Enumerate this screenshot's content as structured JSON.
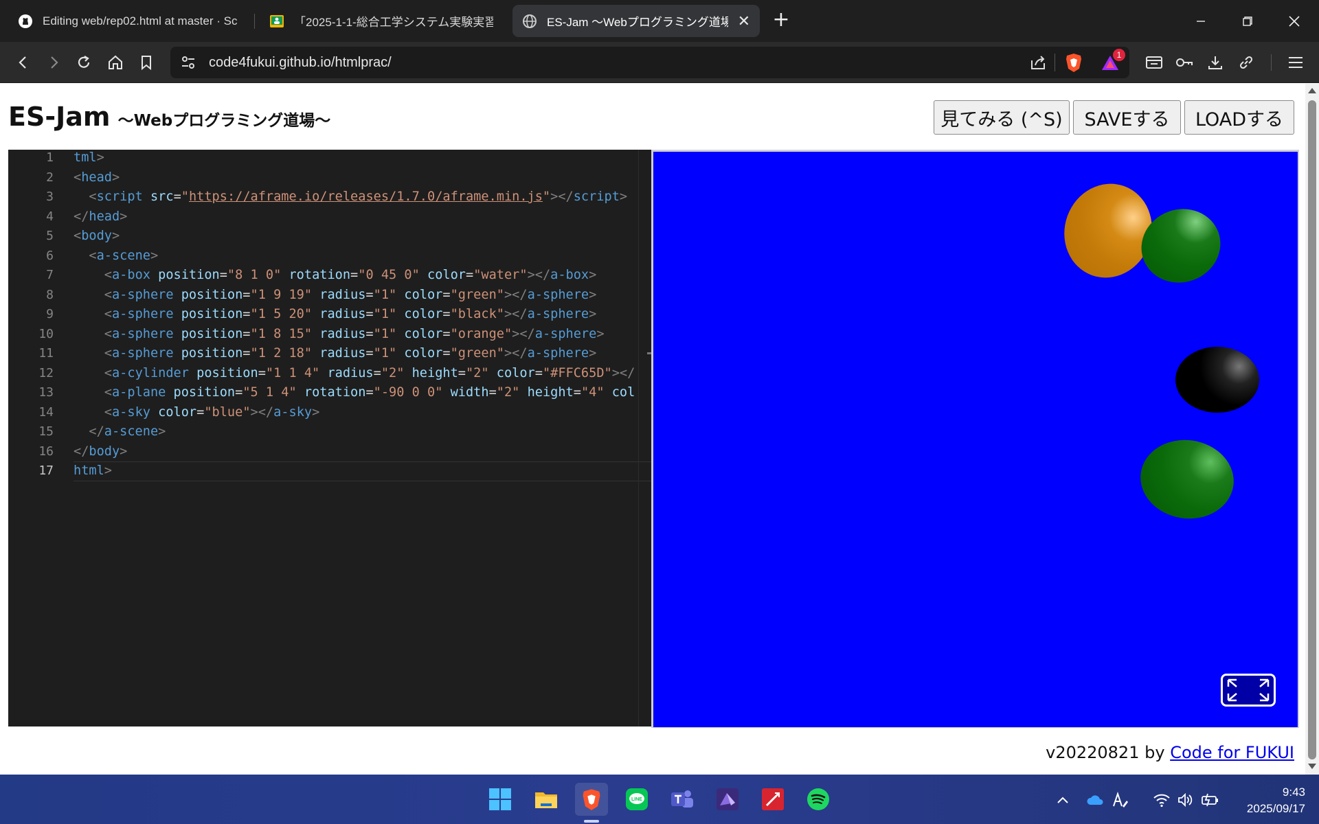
{
  "tabs": [
    {
      "title": "Editing web/rep02.html at master · Sc",
      "favicon": "github-icon",
      "active": false
    },
    {
      "title": "「2025-1-1-総合工学システム実験実習",
      "favicon": "classroom-icon",
      "active": false
    },
    {
      "title": "ES-Jam 〜Webプログラミング道場〜",
      "favicon": "globe-icon",
      "active": true
    }
  ],
  "address_bar": {
    "url": "code4fukui.github.io/htmlprac/"
  },
  "badges": {
    "rewards": "1"
  },
  "page": {
    "title": "ES-Jam",
    "subtitle": "〜Webプログラミング道場〜",
    "buttons": {
      "preview": "見てみる (^S)",
      "save": "SAVEする",
      "load": "LOADする"
    },
    "footer_version": "v20220821 by",
    "footer_link": "Code for FUKUI"
  },
  "editor": {
    "line_numbers": [
      "1",
      "2",
      "3",
      "4",
      "5",
      "6",
      "7",
      "8",
      "9",
      "10",
      "11",
      "12",
      "13",
      "14",
      "15",
      "16",
      "17"
    ],
    "current_line": 17,
    "lines": [
      [
        {
          "c": "tag",
          "t": "tml"
        },
        {
          "c": "br",
          "t": ">"
        }
      ],
      [
        {
          "c": "br",
          "t": "<"
        },
        {
          "c": "tag",
          "t": "head"
        },
        {
          "c": "br",
          "t": ">"
        }
      ],
      [
        {
          "c": "sp",
          "t": "  "
        },
        {
          "c": "br",
          "t": "<"
        },
        {
          "c": "tag",
          "t": "script "
        },
        {
          "c": "attr",
          "t": "src"
        },
        {
          "c": "eq",
          "t": "="
        },
        {
          "c": "str",
          "t": "\""
        },
        {
          "c": "url",
          "t": "https://aframe.io/releases/1.7.0/aframe.min.js"
        },
        {
          "c": "str",
          "t": "\""
        },
        {
          "c": "br",
          "t": "></"
        },
        {
          "c": "tag",
          "t": "script"
        },
        {
          "c": "br",
          "t": ">"
        }
      ],
      [
        {
          "c": "br",
          "t": "</"
        },
        {
          "c": "tag",
          "t": "head"
        },
        {
          "c": "br",
          "t": ">"
        }
      ],
      [
        {
          "c": "br",
          "t": "<"
        },
        {
          "c": "tag",
          "t": "body"
        },
        {
          "c": "br",
          "t": ">"
        }
      ],
      [
        {
          "c": "sp",
          "t": "  "
        },
        {
          "c": "br",
          "t": "<"
        },
        {
          "c": "tag",
          "t": "a-scene"
        },
        {
          "c": "br",
          "t": ">"
        }
      ],
      [
        {
          "c": "sp",
          "t": "    "
        },
        {
          "c": "br",
          "t": "<"
        },
        {
          "c": "tag",
          "t": "a-box "
        },
        {
          "c": "attr",
          "t": "position"
        },
        {
          "c": "eq",
          "t": "="
        },
        {
          "c": "str",
          "t": "\"8 1 0\" "
        },
        {
          "c": "attr",
          "t": "rotation"
        },
        {
          "c": "eq",
          "t": "="
        },
        {
          "c": "str",
          "t": "\"0 45 0\" "
        },
        {
          "c": "attr",
          "t": "color"
        },
        {
          "c": "eq",
          "t": "="
        },
        {
          "c": "str",
          "t": "\"water\""
        },
        {
          "c": "br",
          "t": "></"
        },
        {
          "c": "tag",
          "t": "a-box"
        },
        {
          "c": "br",
          "t": ">"
        }
      ],
      [
        {
          "c": "sp",
          "t": "    "
        },
        {
          "c": "br",
          "t": "<"
        },
        {
          "c": "tag",
          "t": "a-sphere "
        },
        {
          "c": "attr",
          "t": "position"
        },
        {
          "c": "eq",
          "t": "="
        },
        {
          "c": "str",
          "t": "\"1 9 19\" "
        },
        {
          "c": "attr",
          "t": "radius"
        },
        {
          "c": "eq",
          "t": "="
        },
        {
          "c": "str",
          "t": "\"1\" "
        },
        {
          "c": "attr",
          "t": "color"
        },
        {
          "c": "eq",
          "t": "="
        },
        {
          "c": "str",
          "t": "\"green\""
        },
        {
          "c": "br",
          "t": "></"
        },
        {
          "c": "tag",
          "t": "a-sphere"
        },
        {
          "c": "br",
          "t": ">"
        }
      ],
      [
        {
          "c": "sp",
          "t": "    "
        },
        {
          "c": "br",
          "t": "<"
        },
        {
          "c": "tag",
          "t": "a-sphere "
        },
        {
          "c": "attr",
          "t": "position"
        },
        {
          "c": "eq",
          "t": "="
        },
        {
          "c": "str",
          "t": "\"1 5 20\" "
        },
        {
          "c": "attr",
          "t": "radius"
        },
        {
          "c": "eq",
          "t": "="
        },
        {
          "c": "str",
          "t": "\"1\" "
        },
        {
          "c": "attr",
          "t": "color"
        },
        {
          "c": "eq",
          "t": "="
        },
        {
          "c": "str",
          "t": "\"black\""
        },
        {
          "c": "br",
          "t": "></"
        },
        {
          "c": "tag",
          "t": "a-sphere"
        },
        {
          "c": "br",
          "t": ">"
        }
      ],
      [
        {
          "c": "sp",
          "t": "    "
        },
        {
          "c": "br",
          "t": "<"
        },
        {
          "c": "tag",
          "t": "a-sphere "
        },
        {
          "c": "attr",
          "t": "position"
        },
        {
          "c": "eq",
          "t": "="
        },
        {
          "c": "str",
          "t": "\"1 8 15\" "
        },
        {
          "c": "attr",
          "t": "radius"
        },
        {
          "c": "eq",
          "t": "="
        },
        {
          "c": "str",
          "t": "\"1\" "
        },
        {
          "c": "attr",
          "t": "color"
        },
        {
          "c": "eq",
          "t": "="
        },
        {
          "c": "str",
          "t": "\"orange\""
        },
        {
          "c": "br",
          "t": "></"
        },
        {
          "c": "tag",
          "t": "a-sphere"
        },
        {
          "c": "br",
          "t": ">"
        }
      ],
      [
        {
          "c": "sp",
          "t": "    "
        },
        {
          "c": "br",
          "t": "<"
        },
        {
          "c": "tag",
          "t": "a-sphere "
        },
        {
          "c": "attr",
          "t": "position"
        },
        {
          "c": "eq",
          "t": "="
        },
        {
          "c": "str",
          "t": "\"1 2 18\" "
        },
        {
          "c": "attr",
          "t": "radius"
        },
        {
          "c": "eq",
          "t": "="
        },
        {
          "c": "str",
          "t": "\"1\" "
        },
        {
          "c": "attr",
          "t": "color"
        },
        {
          "c": "eq",
          "t": "="
        },
        {
          "c": "str",
          "t": "\"green\""
        },
        {
          "c": "br",
          "t": "></"
        },
        {
          "c": "tag",
          "t": "a-sphere"
        },
        {
          "c": "br",
          "t": ">"
        }
      ],
      [
        {
          "c": "sp",
          "t": "    "
        },
        {
          "c": "br",
          "t": "<"
        },
        {
          "c": "tag",
          "t": "a-cylinder "
        },
        {
          "c": "attr",
          "t": "position"
        },
        {
          "c": "eq",
          "t": "="
        },
        {
          "c": "str",
          "t": "\"1 1 4\" "
        },
        {
          "c": "attr",
          "t": "radius"
        },
        {
          "c": "eq",
          "t": "="
        },
        {
          "c": "str",
          "t": "\"2\" "
        },
        {
          "c": "attr",
          "t": "height"
        },
        {
          "c": "eq",
          "t": "="
        },
        {
          "c": "str",
          "t": "\"2\" "
        },
        {
          "c": "attr",
          "t": "color"
        },
        {
          "c": "eq",
          "t": "="
        },
        {
          "c": "str",
          "t": "\"#FFC65D\""
        },
        {
          "c": "br",
          "t": "></"
        }
      ],
      [
        {
          "c": "sp",
          "t": "    "
        },
        {
          "c": "br",
          "t": "<"
        },
        {
          "c": "tag",
          "t": "a-plane "
        },
        {
          "c": "attr",
          "t": "position"
        },
        {
          "c": "eq",
          "t": "="
        },
        {
          "c": "str",
          "t": "\"5 1 4\" "
        },
        {
          "c": "attr",
          "t": "rotation"
        },
        {
          "c": "eq",
          "t": "="
        },
        {
          "c": "str",
          "t": "\"-90 0 0\" "
        },
        {
          "c": "attr",
          "t": "width"
        },
        {
          "c": "eq",
          "t": "="
        },
        {
          "c": "str",
          "t": "\"2\" "
        },
        {
          "c": "attr",
          "t": "height"
        },
        {
          "c": "eq",
          "t": "="
        },
        {
          "c": "str",
          "t": "\"4\" "
        },
        {
          "c": "attr",
          "t": "col"
        }
      ],
      [
        {
          "c": "sp",
          "t": "    "
        },
        {
          "c": "br",
          "t": "<"
        },
        {
          "c": "tag",
          "t": "a-sky "
        },
        {
          "c": "attr",
          "t": "color"
        },
        {
          "c": "eq",
          "t": "="
        },
        {
          "c": "str",
          "t": "\"blue\""
        },
        {
          "c": "br",
          "t": "></"
        },
        {
          "c": "tag",
          "t": "a-sky"
        },
        {
          "c": "br",
          "t": ">"
        }
      ],
      [
        {
          "c": "sp",
          "t": "  "
        },
        {
          "c": "br",
          "t": "</"
        },
        {
          "c": "tag",
          "t": "a-scene"
        },
        {
          "c": "br",
          "t": ">"
        }
      ],
      [
        {
          "c": "br",
          "t": "</"
        },
        {
          "c": "tag",
          "t": "body"
        },
        {
          "c": "br",
          "t": ">"
        }
      ],
      [
        {
          "c": "tag",
          "t": "html"
        },
        {
          "c": "br",
          "t": ">"
        }
      ]
    ]
  },
  "scene": {
    "sky_color": "#0000ff",
    "spheres": [
      {
        "name": "orange-sphere",
        "color": "#c77b0a"
      },
      {
        "name": "green-sphere-top",
        "color": "#0a6a0a"
      },
      {
        "name": "black-sphere",
        "color": "#000000"
      },
      {
        "name": "green-sphere-bottom",
        "color": "#0a6a0a"
      }
    ],
    "vr_button": "fullscreen-icon"
  },
  "taskbar": {
    "apps": [
      "windows-start-icon",
      "file-explorer-icon",
      "brave-icon",
      "line-icon",
      "teams-icon",
      "vs-app-icon",
      "pdf-app-icon",
      "spotify-icon"
    ],
    "active_app": "brave-icon",
    "tray": [
      "chevron-up-icon",
      "onedrive-icon",
      "pen-input-icon",
      "wifi-icon",
      "volume-icon",
      "battery-icon"
    ],
    "time": "9:43",
    "date": "2025/09/17"
  },
  "colors": {
    "accent": "#0000ee",
    "editor_bg": "#1e1e1e",
    "tag": "#569cd6",
    "attr": "#9cdcfe",
    "string": "#ce9178"
  }
}
